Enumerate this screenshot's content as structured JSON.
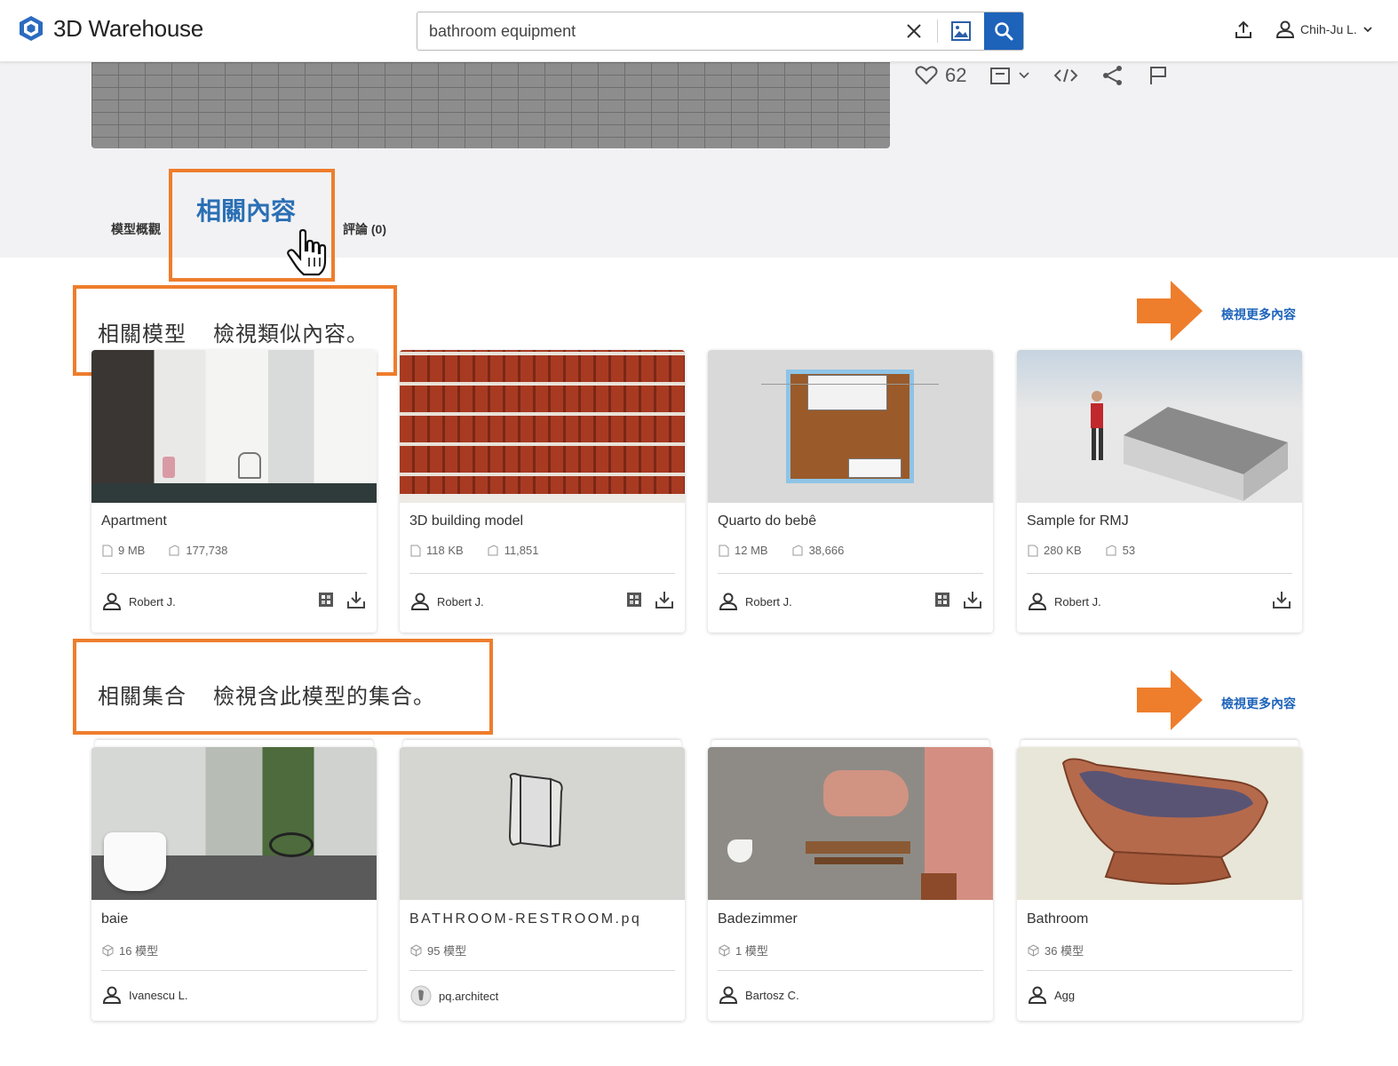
{
  "header": {
    "logo_text": "3D Warehouse",
    "search_value": "bathroom equipment",
    "user_name": "Chih-Ju L."
  },
  "model_actions": {
    "likes_count": "62"
  },
  "tabs": {
    "overview": "模型概觀",
    "related": "相關內容",
    "comments": "評論 (0)"
  },
  "related_models": {
    "title": "相關模型",
    "subtitle": "檢視類似內容。",
    "view_more": "檢視更多內容",
    "items": [
      {
        "title": "Apartment",
        "size": "9 MB",
        "views": "177,738",
        "author": "Robert J."
      },
      {
        "title": "3D building model",
        "size": "118 KB",
        "views": "11,851",
        "author": "Robert J."
      },
      {
        "title": "Quarto do bebê",
        "size": "12 MB",
        "views": "38,666",
        "author": "Robert J."
      },
      {
        "title": "Sample for RMJ",
        "size": "280 KB",
        "views": "53",
        "author": "Robert J."
      }
    ]
  },
  "related_collections": {
    "title": "相關集合",
    "subtitle": "檢視含此模型的集合。",
    "view_more": "檢視更多內容",
    "items": [
      {
        "title": "baie",
        "count": "16 模型",
        "author": "Ivanescu L."
      },
      {
        "title": "BATHROOM-RESTROOM.pq",
        "count": "95 模型",
        "author": "pq.architect"
      },
      {
        "title": "Badezimmer",
        "count": "1 模型",
        "author": "Bartosz C."
      },
      {
        "title": "Bathroom",
        "count": "36 模型",
        "author": "Agg"
      }
    ]
  },
  "colors": {
    "accent": "#1d63ba",
    "highlight": "#ee7d2c",
    "tab_active": "#2a6fb5"
  }
}
